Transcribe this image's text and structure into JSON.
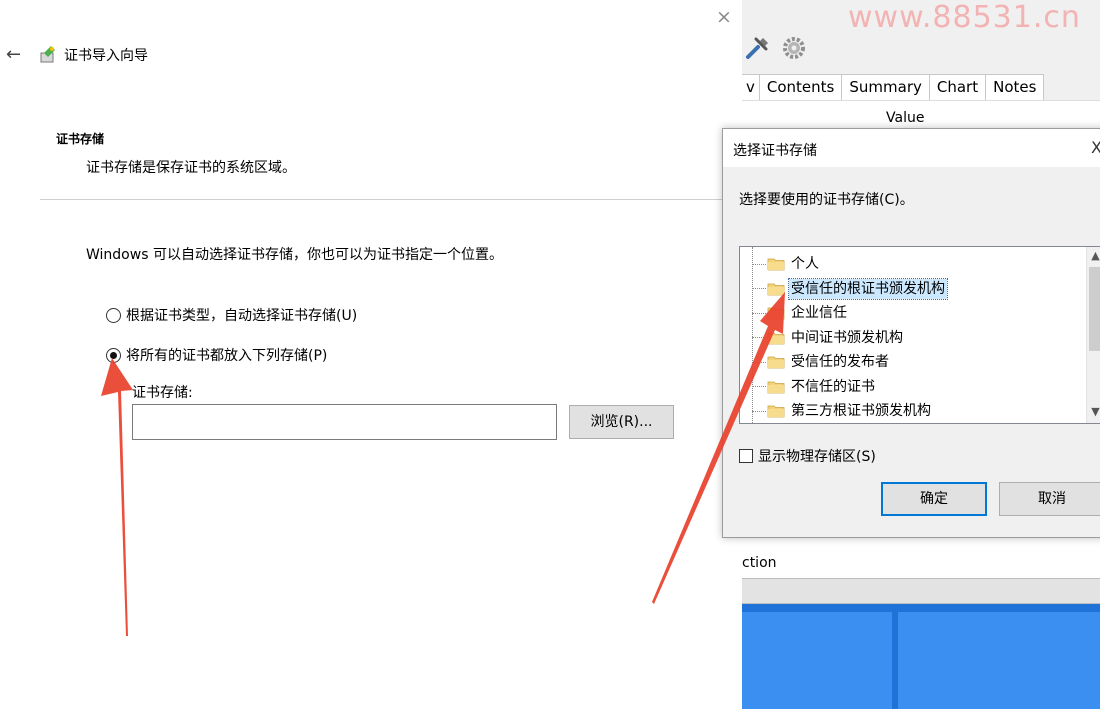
{
  "watermark": "www.88531.cn",
  "wizard": {
    "title": "证书导入向导",
    "section_title": "证书存储",
    "section_desc": "证书存储是保存证书的系统区域。",
    "intro": "Windows 可以自动选择证书存储，你也可以为证书指定一个位置。",
    "radio_auto": "根据证书类型，自动选择证书存储(U)",
    "radio_manual": "将所有的证书都放入下列存储(P)",
    "store_label": "证书存储:",
    "store_value": "",
    "browse_label": "浏览(R)...",
    "close_glyph": "×",
    "back_glyph": "←"
  },
  "background_app": {
    "tabs": [
      "v",
      "Contents",
      "Summary",
      "Chart",
      "Notes"
    ],
    "value_header": "Value",
    "cut_text": "ction",
    "dash": "-"
  },
  "dialog": {
    "title": "选择证书存储",
    "close_glyph": "X",
    "prompt": "选择要使用的证书存储(C)。",
    "tree_items": [
      {
        "label": "个人",
        "selected": false
      },
      {
        "label": "受信任的根证书颁发机构",
        "selected": true
      },
      {
        "label": "企业信任",
        "selected": false
      },
      {
        "label": "中间证书颁发机构",
        "selected": false
      },
      {
        "label": "受信任的发布者",
        "selected": false
      },
      {
        "label": "不信任的证书",
        "selected": false
      },
      {
        "label": "第三方根证书颁发机构",
        "selected": false
      }
    ],
    "show_physical": "显示物理存储区(S)",
    "ok": "确定",
    "cancel": "取消"
  },
  "colors": {
    "accent": "#0078d7",
    "selection": "#cce8ff",
    "annotation_arrow": "#e8402b",
    "watermark": "#f3b3b3",
    "desktop": "#1f73d8"
  }
}
